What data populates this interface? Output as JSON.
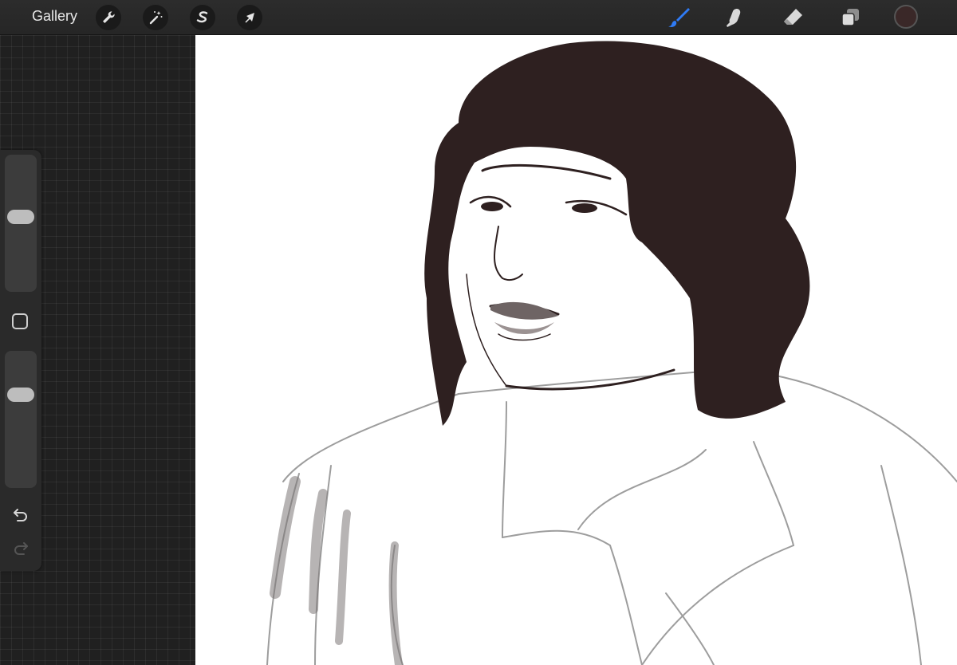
{
  "toolbar": {
    "gallery_label": "Gallery",
    "left_tools": [
      {
        "name": "actions",
        "icon": "wrench-icon"
      },
      {
        "name": "adjustments",
        "icon": "magic-wand-icon"
      },
      {
        "name": "selection",
        "icon": "selection-s-icon"
      },
      {
        "name": "transform",
        "icon": "arrow-cursor-icon"
      }
    ],
    "right_tools": [
      {
        "name": "brush",
        "icon": "brush-icon",
        "active": true
      },
      {
        "name": "smudge",
        "icon": "smudge-finger-icon"
      },
      {
        "name": "eraser",
        "icon": "eraser-icon"
      },
      {
        "name": "layers",
        "icon": "layers-icon"
      }
    ],
    "active_color": "#3a2828",
    "active_tool_color": "#2f7bf5"
  },
  "sidebar": {
    "brush_size_level": 0.55,
    "opacity_level": 0.7,
    "modify_button_icon": "square-icon",
    "undo_icon": "undo-icon",
    "redo_icon": "redo-icon"
  },
  "canvas": {
    "content": "drawing",
    "ink_color": "#2e2020",
    "sketch_color": "#8c8c8c"
  }
}
